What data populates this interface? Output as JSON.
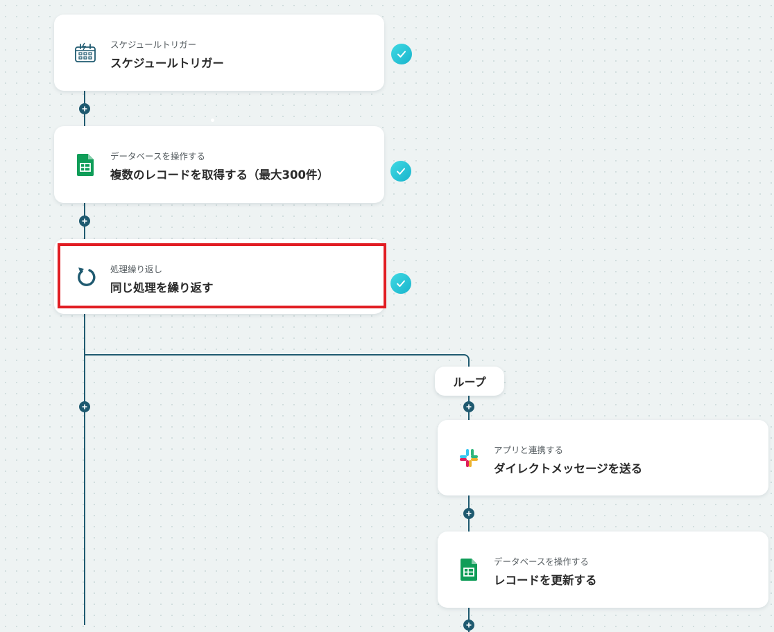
{
  "flow": {
    "step1": {
      "sub": "スケジュールトリガー",
      "title": "スケジュールトリガー",
      "icon": "schedule-calendar-icon",
      "completed": true
    },
    "step2": {
      "sub": "データベースを操作する",
      "title": "複数のレコードを取得する（最大300件）",
      "icon": "google-sheets-icon",
      "completed": true
    },
    "step3": {
      "sub": "処理繰り返し",
      "title": "同じ処理を繰り返す",
      "icon": "loop-repeat-icon",
      "completed": true,
      "highlighted": true
    },
    "loop": {
      "label": "ループ",
      "steps": [
        {
          "sub": "アプリと連携する",
          "title": "ダイレクトメッセージを送る",
          "icon": "slack-icon"
        },
        {
          "sub": "データベースを操作する",
          "title": "レコードを更新する",
          "icon": "google-sheets-icon"
        }
      ]
    }
  },
  "colors": {
    "connector": "#1f5a70",
    "check": "#19b4cc",
    "highlight": "#e11d23",
    "sheets_green": "#0f9d58",
    "background": "#eef3f3"
  }
}
